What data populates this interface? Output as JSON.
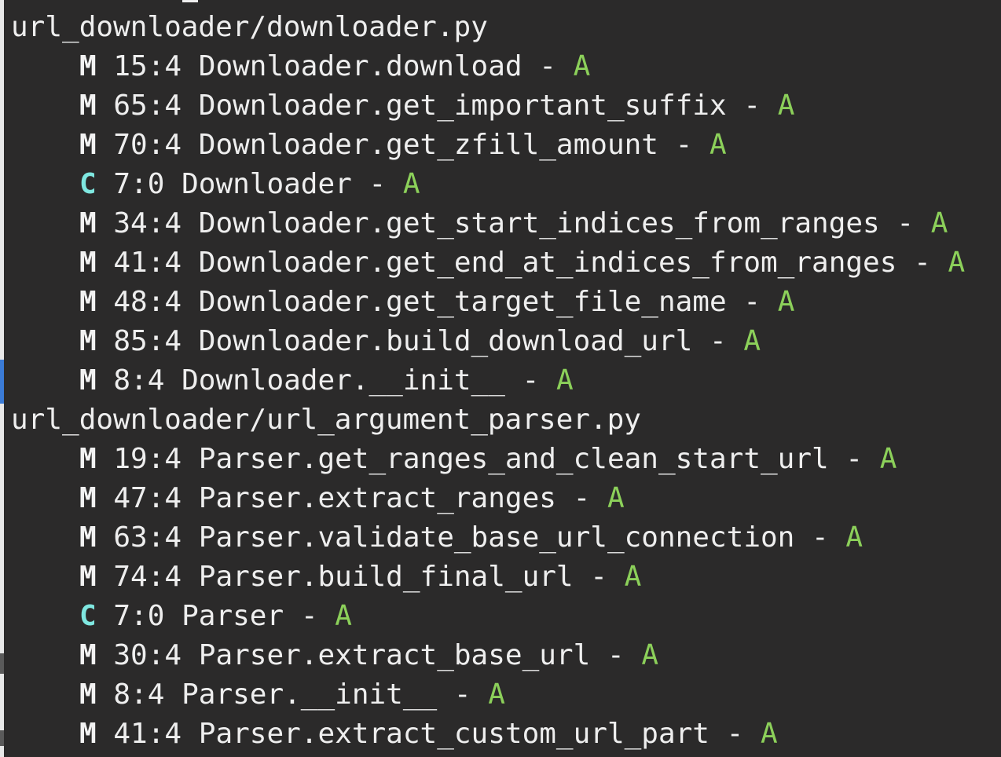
{
  "colors": {
    "background": "#2b2a2a",
    "text": "#eeeeee",
    "grade_A": "#8cd05a",
    "class_kind": "#7fe7e0"
  },
  "files": [
    {
      "path": "url_downloader/downloader.py",
      "entries": [
        {
          "kind": "M",
          "location": "15:4",
          "name": "Downloader.download",
          "sep": "-",
          "grade": "A"
        },
        {
          "kind": "M",
          "location": "65:4",
          "name": "Downloader.get_important_suffix",
          "sep": "-",
          "grade": "A"
        },
        {
          "kind": "M",
          "location": "70:4",
          "name": "Downloader.get_zfill_amount",
          "sep": "-",
          "grade": "A"
        },
        {
          "kind": "C",
          "location": "7:0",
          "name": "Downloader",
          "sep": "-",
          "grade": "A"
        },
        {
          "kind": "M",
          "location": "34:4",
          "name": "Downloader.get_start_indices_from_ranges",
          "sep": "-",
          "grade": "A"
        },
        {
          "kind": "M",
          "location": "41:4",
          "name": "Downloader.get_end_at_indices_from_ranges",
          "sep": "-",
          "grade": "A"
        },
        {
          "kind": "M",
          "location": "48:4",
          "name": "Downloader.get_target_file_name",
          "sep": "-",
          "grade": "A"
        },
        {
          "kind": "M",
          "location": "85:4",
          "name": "Downloader.build_download_url",
          "sep": "-",
          "grade": "A"
        },
        {
          "kind": "M",
          "location": "8:4",
          "name": "Downloader.__init__",
          "sep": "-",
          "grade": "A"
        }
      ]
    },
    {
      "path": "url_downloader/url_argument_parser.py",
      "entries": [
        {
          "kind": "M",
          "location": "19:4",
          "name": "Parser.get_ranges_and_clean_start_url",
          "sep": "-",
          "grade": "A"
        },
        {
          "kind": "M",
          "location": "47:4",
          "name": "Parser.extract_ranges",
          "sep": "-",
          "grade": "A"
        },
        {
          "kind": "M",
          "location": "63:4",
          "name": "Parser.validate_base_url_connection",
          "sep": "-",
          "grade": "A"
        },
        {
          "kind": "M",
          "location": "74:4",
          "name": "Parser.build_final_url",
          "sep": "-",
          "grade": "A"
        },
        {
          "kind": "C",
          "location": "7:0",
          "name": "Parser",
          "sep": "-",
          "grade": "A"
        },
        {
          "kind": "M",
          "location": "30:4",
          "name": "Parser.extract_base_url",
          "sep": "-",
          "grade": "A"
        },
        {
          "kind": "M",
          "location": "8:4",
          "name": "Parser.__init__",
          "sep": "-",
          "grade": "A"
        },
        {
          "kind": "M",
          "location": "41:4",
          "name": "Parser.extract_custom_url_part",
          "sep": "-",
          "grade": "A"
        }
      ]
    }
  ]
}
